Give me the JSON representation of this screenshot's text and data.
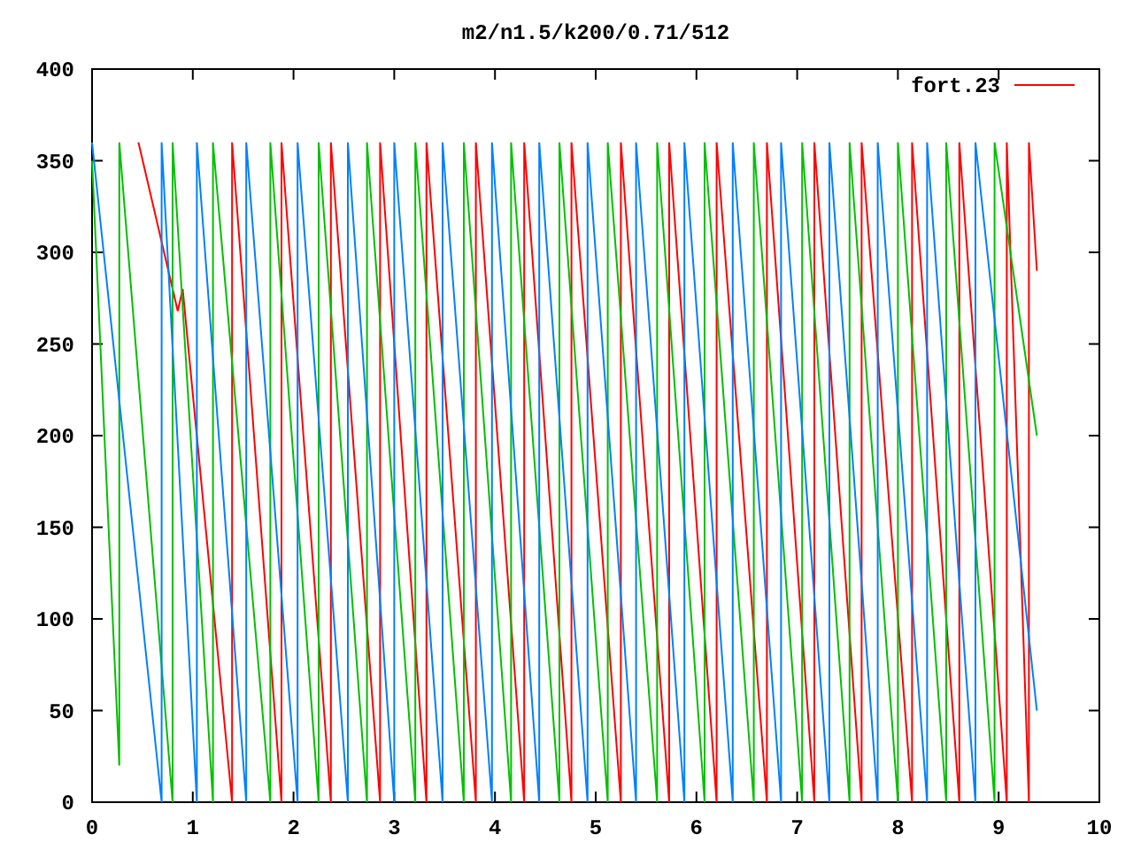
{
  "plot": {
    "chart_data": {
      "type": "line",
      "title": "m2/n1.5/k200/0.71/512",
      "xlim": [
        0,
        10
      ],
      "ylim": [
        0,
        400
      ],
      "xticks": [
        0,
        1,
        2,
        3,
        4,
        5,
        6,
        7,
        8,
        9,
        10
      ],
      "yticks": [
        0,
        50,
        100,
        150,
        200,
        250,
        300,
        350,
        400
      ],
      "series": [
        {
          "name": "fort.23",
          "color": "#ff0000",
          "x": [
            0.46,
            0.85,
            0.9,
            1.39,
            1.39,
            1.88,
            1.88,
            2.37,
            2.37,
            2.86,
            2.86,
            3.32,
            3.32,
            3.81,
            3.81,
            4.29,
            4.29,
            4.76,
            4.76,
            5.25,
            5.25,
            5.73,
            5.73,
            6.2,
            6.2,
            6.7,
            6.7,
            7.17,
            7.17,
            7.64,
            7.64,
            8.14,
            8.14,
            8.61,
            8.61,
            9.08,
            9.08,
            9.3,
            9.3,
            9.38
          ],
          "values": [
            360,
            268,
            280,
            0,
            360,
            0,
            360,
            0,
            360,
            0,
            360,
            0,
            360,
            0,
            360,
            0,
            360,
            0,
            360,
            0,
            360,
            0,
            360,
            0,
            360,
            0,
            360,
            0,
            360,
            0,
            360,
            0,
            360,
            0,
            360,
            0,
            360,
            0,
            360,
            290
          ]
        },
        {
          "color": "#00c000",
          "x": [
            0,
            0.27,
            0.27,
            0.8,
            0.8,
            1.2,
            1.2,
            1.77,
            1.77,
            2.25,
            2.25,
            2.73,
            2.73,
            3.21,
            3.21,
            3.69,
            3.69,
            4.16,
            4.16,
            4.64,
            4.64,
            5.12,
            5.12,
            5.61,
            5.61,
            6.08,
            6.08,
            6.57,
            6.57,
            7.05,
            7.05,
            7.52,
            7.52,
            8.0,
            8.0,
            8.48,
            8.48,
            8.96,
            8.96,
            9.38
          ],
          "values": [
            350,
            20,
            360,
            0,
            360,
            0,
            360,
            0,
            360,
            0,
            360,
            0,
            360,
            0,
            360,
            0,
            360,
            0,
            360,
            0,
            360,
            0,
            360,
            0,
            360,
            0,
            360,
            0,
            360,
            0,
            360,
            0,
            360,
            0,
            360,
            0,
            360,
            0,
            360,
            200
          ]
        },
        {
          "color": "#0080ff",
          "x": [
            0,
            0.69,
            0.69,
            1.04,
            1.04,
            1.53,
            1.53,
            2.04,
            2.04,
            2.54,
            2.54,
            3.0,
            3.0,
            3.48,
            3.48,
            3.97,
            3.97,
            4.44,
            4.44,
            4.92,
            4.92,
            5.4,
            5.4,
            5.88,
            5.88,
            6.36,
            6.36,
            6.84,
            6.84,
            7.32,
            7.32,
            7.8,
            7.8,
            8.29,
            8.29,
            8.77,
            8.77,
            9.38
          ],
          "values": [
            360,
            0,
            360,
            0,
            360,
            0,
            360,
            0,
            360,
            0,
            360,
            0,
            360,
            0,
            360,
            0,
            360,
            0,
            360,
            0,
            360,
            0,
            360,
            0,
            360,
            0,
            360,
            0,
            360,
            0,
            360,
            0,
            360,
            0,
            360,
            0,
            360,
            50
          ]
        }
      ]
    }
  }
}
